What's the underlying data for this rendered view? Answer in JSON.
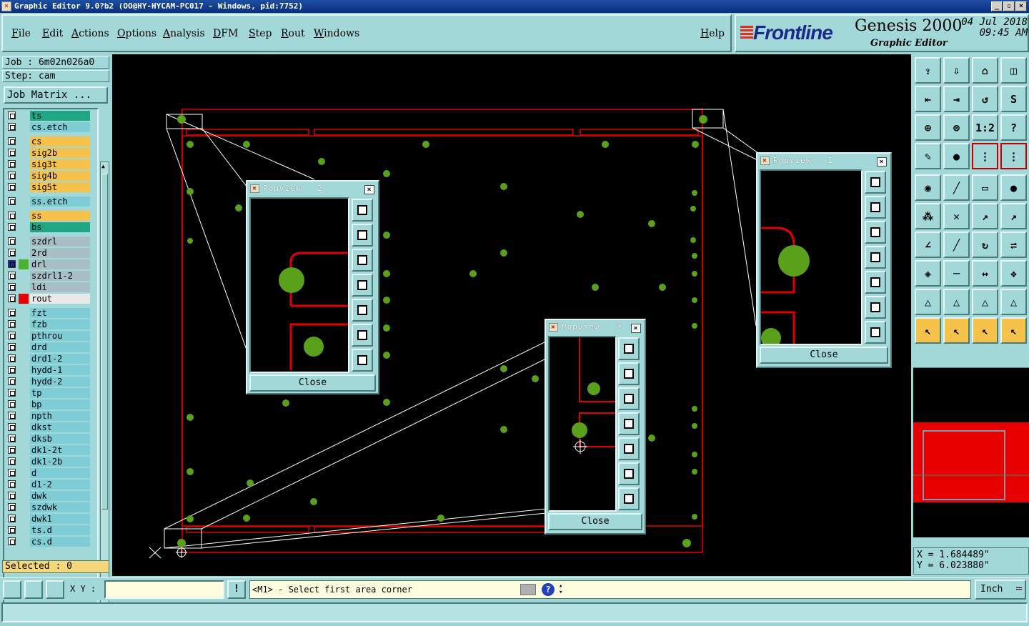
{
  "window": {
    "title": "Graphic Editor 9.0?b2  (OO@HY-HYCAM-PC017 - Windows, pid:7752)"
  },
  "menu": [
    "File",
    "Edit",
    "Actions",
    "Options",
    "Analysis",
    "DFM",
    "Step",
    "Rout",
    "Windows"
  ],
  "help": "Help",
  "brand": {
    "logo": "Frontline",
    "product": "Genesis 2000",
    "subtitle": "Graphic Editor",
    "date": "04 Jul 2018",
    "time": "09:45 AM"
  },
  "job": {
    "job_label": "Job  :  6m02n026a0",
    "step_label": "Step:  cam",
    "matrix_button": "Job Matrix ..."
  },
  "layers": [
    {
      "name": "ts",
      "color": "#1fa784"
    },
    {
      "name": "cs.etch",
      "color": "#7ecdd6"
    },
    {
      "name": "cs",
      "color": "#f6c24a"
    },
    {
      "name": "sig2b",
      "color": "#f6c24a"
    },
    {
      "name": "sig3t",
      "color": "#f6c24a"
    },
    {
      "name": "sig4b",
      "color": "#f6c24a"
    },
    {
      "name": "sig5t",
      "color": "#f6c24a"
    },
    {
      "name": "ss.etch",
      "color": "#7ecdd6"
    },
    {
      "name": "ss",
      "color": "#f6c24a"
    },
    {
      "name": "bs",
      "color": "#1fa784"
    },
    {
      "name": "szdrl",
      "color": "#a9bfc6"
    },
    {
      "name": "2rd",
      "color": "#a9bfc6"
    },
    {
      "name": "drl",
      "color": "#a9bfc6"
    },
    {
      "name": "szdrl1-2",
      "color": "#a9bfc6"
    },
    {
      "name": "ldi",
      "color": "#a9bfc6"
    },
    {
      "name": "rout",
      "color": "#e9e9e9"
    },
    {
      "name": "fzt",
      "color": "#7ecdd6"
    },
    {
      "name": "fzb",
      "color": "#7ecdd6"
    },
    {
      "name": "pthrou",
      "color": "#7ecdd6"
    },
    {
      "name": "drd",
      "color": "#7ecdd6"
    },
    {
      "name": "drd1-2",
      "color": "#7ecdd6"
    },
    {
      "name": "hydd-1",
      "color": "#7ecdd6"
    },
    {
      "name": "hydd-2",
      "color": "#7ecdd6"
    },
    {
      "name": "tp",
      "color": "#7ecdd6"
    },
    {
      "name": "bp",
      "color": "#7ecdd6"
    },
    {
      "name": "npth",
      "color": "#7ecdd6"
    },
    {
      "name": "dkst",
      "color": "#7ecdd6"
    },
    {
      "name": "dksb",
      "color": "#7ecdd6"
    },
    {
      "name": "dk1-2t",
      "color": "#7ecdd6"
    },
    {
      "name": "dk1-2b",
      "color": "#7ecdd6"
    },
    {
      "name": "d",
      "color": "#7ecdd6"
    },
    {
      "name": "d1-2",
      "color": "#7ecdd6"
    },
    {
      "name": "dwk",
      "color": "#7ecdd6"
    },
    {
      "name": "szdwk",
      "color": "#7ecdd6"
    },
    {
      "name": "dwk1",
      "color": "#7ecdd6"
    },
    {
      "name": "ts.d",
      "color": "#7ecdd6"
    },
    {
      "name": "cs.d",
      "color": "#7ecdd6"
    }
  ],
  "selected": "Selected : 0",
  "popviews": [
    {
      "title": "Popview - 2",
      "close": "Close"
    },
    {
      "title": "Popview - 3",
      "close": "Close"
    },
    {
      "title": "Popview - 1",
      "close": "Close"
    }
  ],
  "coords": {
    "x": "X = 1.684489\"",
    "y": "Y = 6.023880\""
  },
  "bottom": {
    "xy_label": "X Y :",
    "xy_value": "",
    "message": "<M1> - Select first area corner",
    "unit": "Inch"
  },
  "colors": {
    "panel": "#a3d8d8",
    "rout": "#e00000",
    "pad": "#5aa01a",
    "highlight": "#f6d87a"
  }
}
